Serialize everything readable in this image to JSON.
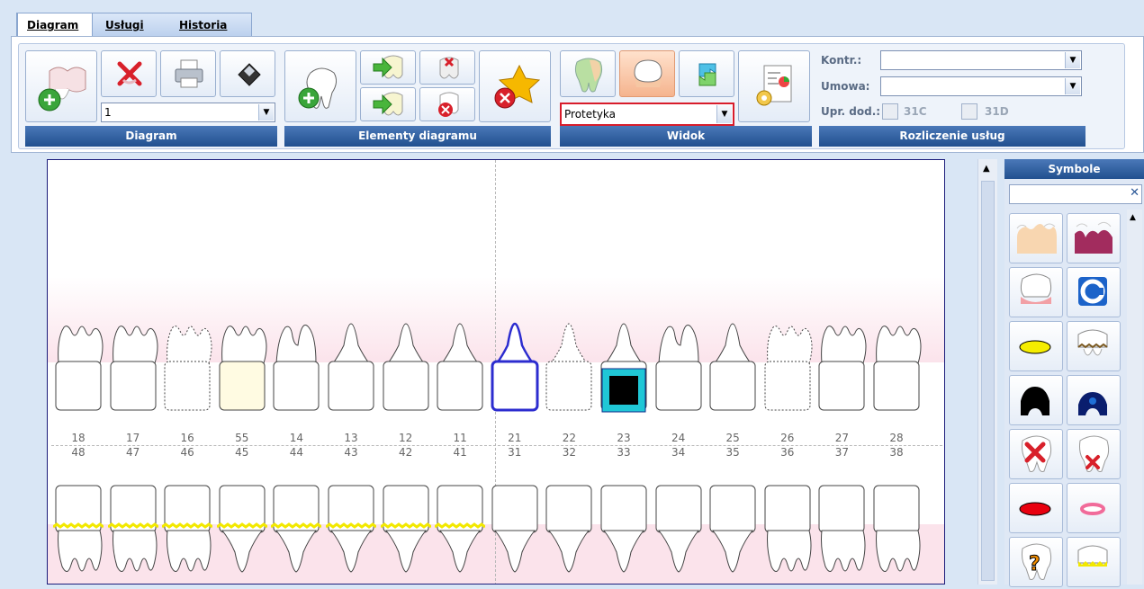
{
  "tabs": [
    {
      "label": "Diagram",
      "active": true
    },
    {
      "label": "Usługi",
      "active": false
    },
    {
      "label": "Historia",
      "active": false
    }
  ],
  "toolbar": {
    "groups": {
      "diagram": "Diagram",
      "elements": "Elementy diagramu",
      "view": "Widok",
      "billing": "Rozliczenie usług"
    },
    "diagram_number": "1",
    "view_value": "Protetyka",
    "kontr_label": "Kontr.:",
    "kontr_value": "",
    "umowa_label": "Umowa:",
    "umowa_value": "",
    "upr_label": "Upr. dod.:",
    "chk_31c": "31C",
    "chk_31d": "31D"
  },
  "teeth": {
    "upper_numbers": [
      "18",
      "17",
      "16",
      "55",
      "14",
      "13",
      "12",
      "11",
      "21",
      "22",
      "23",
      "24",
      "25",
      "26",
      "27",
      "28"
    ],
    "lower_numbers": [
      "48",
      "47",
      "46",
      "45",
      "44",
      "43",
      "42",
      "41",
      "31",
      "32",
      "33",
      "34",
      "35",
      "36",
      "37",
      "38"
    ]
  },
  "symbols": {
    "title": "Symbole",
    "search_value": "",
    "clear_glyph": "✕"
  },
  "colors": {
    "accent_red": "#d81c2b",
    "header_blue": "#2a5797",
    "crown_yellow": "#f2e800",
    "bridge_blue": "#2c2ccf",
    "cyan": "#20c7d6"
  }
}
